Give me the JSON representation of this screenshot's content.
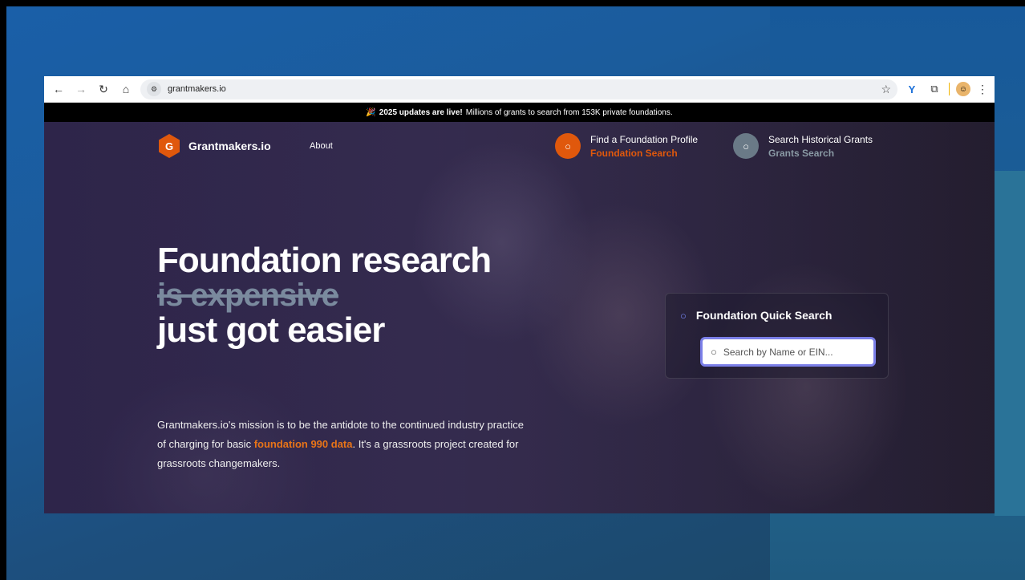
{
  "browser": {
    "url": "grantmakers.io"
  },
  "announcement": {
    "emoji": "🎉",
    "bold": "2025 updates are live!",
    "text": "Millions of grants to search from 153K private foundations."
  },
  "site_nav": {
    "logo_letter": "G",
    "logo_text": "Grantmakers.io",
    "about": "About",
    "foundation_link": {
      "title": "Find a Foundation Profile",
      "subtitle": "Foundation Search"
    },
    "grants_link": {
      "title": "Search Historical Grants",
      "subtitle": "Grants Search"
    }
  },
  "hero": {
    "line1": "Foundation research",
    "line2": "is expensive",
    "line3": "just got easier",
    "mission_before": "Grantmakers.io's mission is to be the antidote to the continued industry practice of charging for basic ",
    "mission_highlight": "foundation 990 data",
    "mission_after": ". It's a grassroots project created for grassroots changemakers."
  },
  "quick_search": {
    "title": "Foundation Quick Search",
    "placeholder": "Search by Name or EIN..."
  },
  "colors": {
    "accent_orange": "#e0580c",
    "input_border": "#7b7fe8"
  }
}
